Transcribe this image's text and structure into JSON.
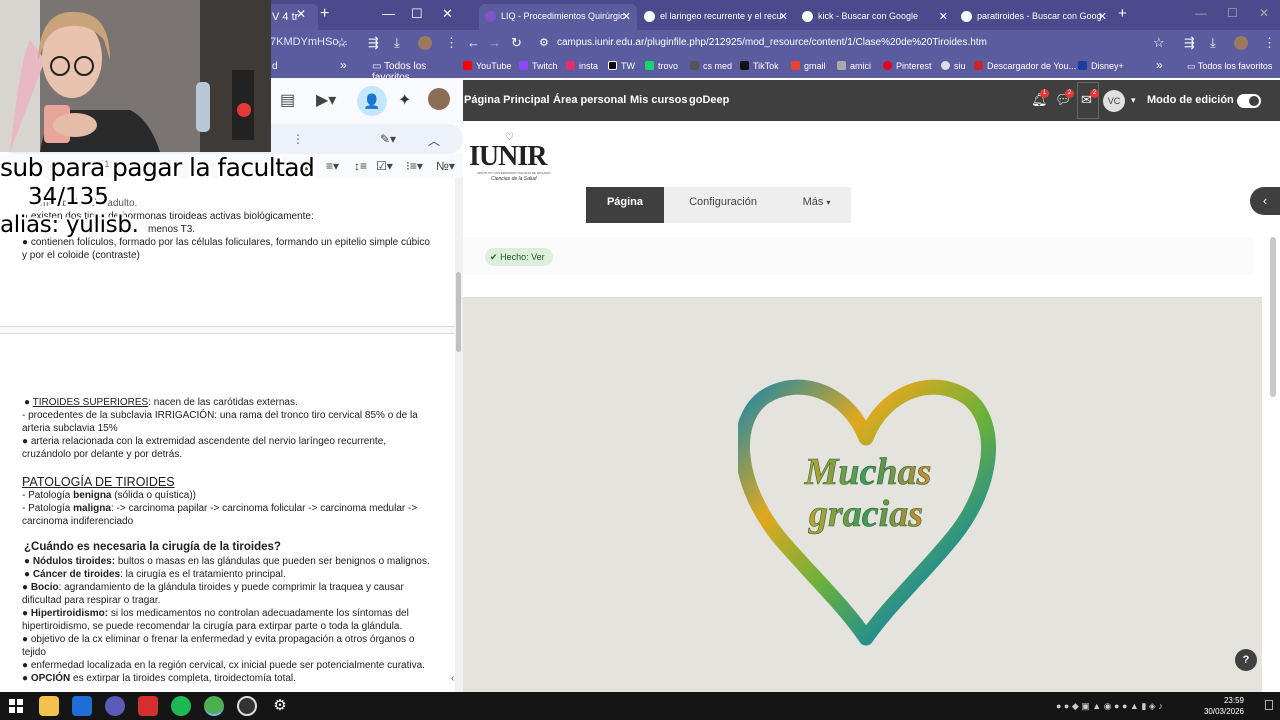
{
  "left_window": {
    "tab_title": "V 4 tr",
    "url_fragment": "7KMDYmHSo...",
    "bookmarks_left": "d",
    "bookmarks_right": "Todos los favoritos",
    "font_size": "11",
    "doc_lines": {
      "l0": "metabólica del adulto.",
      "l1": "existen dos tipos de hormonas tiroideas activas biológicamente:",
      "l2": "menos T3.",
      "l3": "contienen folículos, formado por las células foliculares, formando un epitelio simple cúbico",
      "l4": "y por el coloide (contraste)",
      "l5_pre": "TIROIDES SUPERIORES",
      "l5_post": ": nacen de las carótidas externas.",
      "l6": "- procedentes de la subclavia IRRIGACIÓN: una rama del tronco tiro cervical 85% o de la",
      "l7": "arteria subclavia 15%",
      "l8": "arteria relacionada con la extremidad ascendente del nervio laríngeo recurrente,",
      "l9": "cruzándolo por delante y por detrás.",
      "sec": "PATOLOGÍA DE TIROIDES",
      "p1_pre": " - Patología ",
      "p1_b": "benigna",
      "p1_post": " (sólida o quística))",
      "p2_pre": "- Patología ",
      "p2_b": "maligna",
      "p2_post": ": -> carcinoma papilar -> carcinoma folicular -> carcinoma medular ->",
      "p3": "carcinoma indiferenciado",
      "q": "¿Cuándo es necesaria la cirugía de la tiroides?",
      "b1_b": "Nódulos tiroides:",
      "b1": " bultos o masas en las glándulas que pueden ser benignos o malignos.",
      "b2_b": "Cáncer de tiroides",
      "b2": ": la cirugía es el tratamiento principal.",
      "b3_b": "Bocio",
      "b3": ": agrandamiento de la glándula tiroides y puede comprimir la traquea y causar",
      "b3b": "dificultad para respirar o tragar.",
      "b4_b": "Hipertiroidismo:",
      "b4": " si los medicamentos no controlan adecuadamente los síntomas del",
      "b4b": "hipertiroidismo, se puede recomendar la cirugía para extirpar parte o toda la glándula.",
      "b5": "objetivo de la cx eliminar o frenar la enfermedad y evita propagación a otros órganos o",
      "b5b": "tejido",
      "b6": "enfermedad localizada en la región cervical, cx inicial puede ser potencialmente curativa.",
      "b7_b": "OPCIÓN",
      "b7": " es extirpar la tiroides completa, tiroidectomía total."
    }
  },
  "overlay": {
    "line1": "sub para pagar la facultad",
    "line2": "34/135",
    "line3": "alias: yulisb."
  },
  "right_window": {
    "tabs": [
      {
        "label": "LIQ - Procedimientos Quirúrgic"
      },
      {
        "label": "el laringeo recurrente y el recu"
      },
      {
        "label": "kick - Buscar con Google"
      },
      {
        "label": "paratiroides - Buscar con Goog"
      }
    ],
    "url": "campus.iunir.edu.ar/pluginfile.php/212925/mod_resource/content/1/Clase%20de%20Tiroides.htm",
    "bookmarks": [
      "YouTube",
      "Twitch",
      "insta",
      "TW",
      "trovo",
      "cs med",
      "TikTok",
      "gmail",
      "amici",
      "Pinterest",
      "siu",
      "Descargador de You...",
      "Disney+"
    ],
    "bookmarks_right": "Todos los favoritos",
    "nav": {
      "items": [
        "Página Principal",
        "Área personal",
        "Mis cursos",
        "goDeep"
      ],
      "badges": [
        "1",
        "2",
        "2"
      ],
      "avatar": "VC",
      "edit_mode": "Modo de edición"
    },
    "logo_text": "IUNIR",
    "logo_sub": "INSTITUTO UNIVERSITARIO ITALIANO DE ROSARIO",
    "logo_sub2": "Ciencias de la Salud",
    "page_tabs": [
      "Página",
      "Configuración",
      "Más"
    ],
    "done_label": "Hecho: Ver",
    "heart_text1": "Muchas",
    "heart_text2": "gracias",
    "help": "?"
  },
  "taskbar": {
    "time": "23:59",
    "date": "30/03/2026"
  }
}
